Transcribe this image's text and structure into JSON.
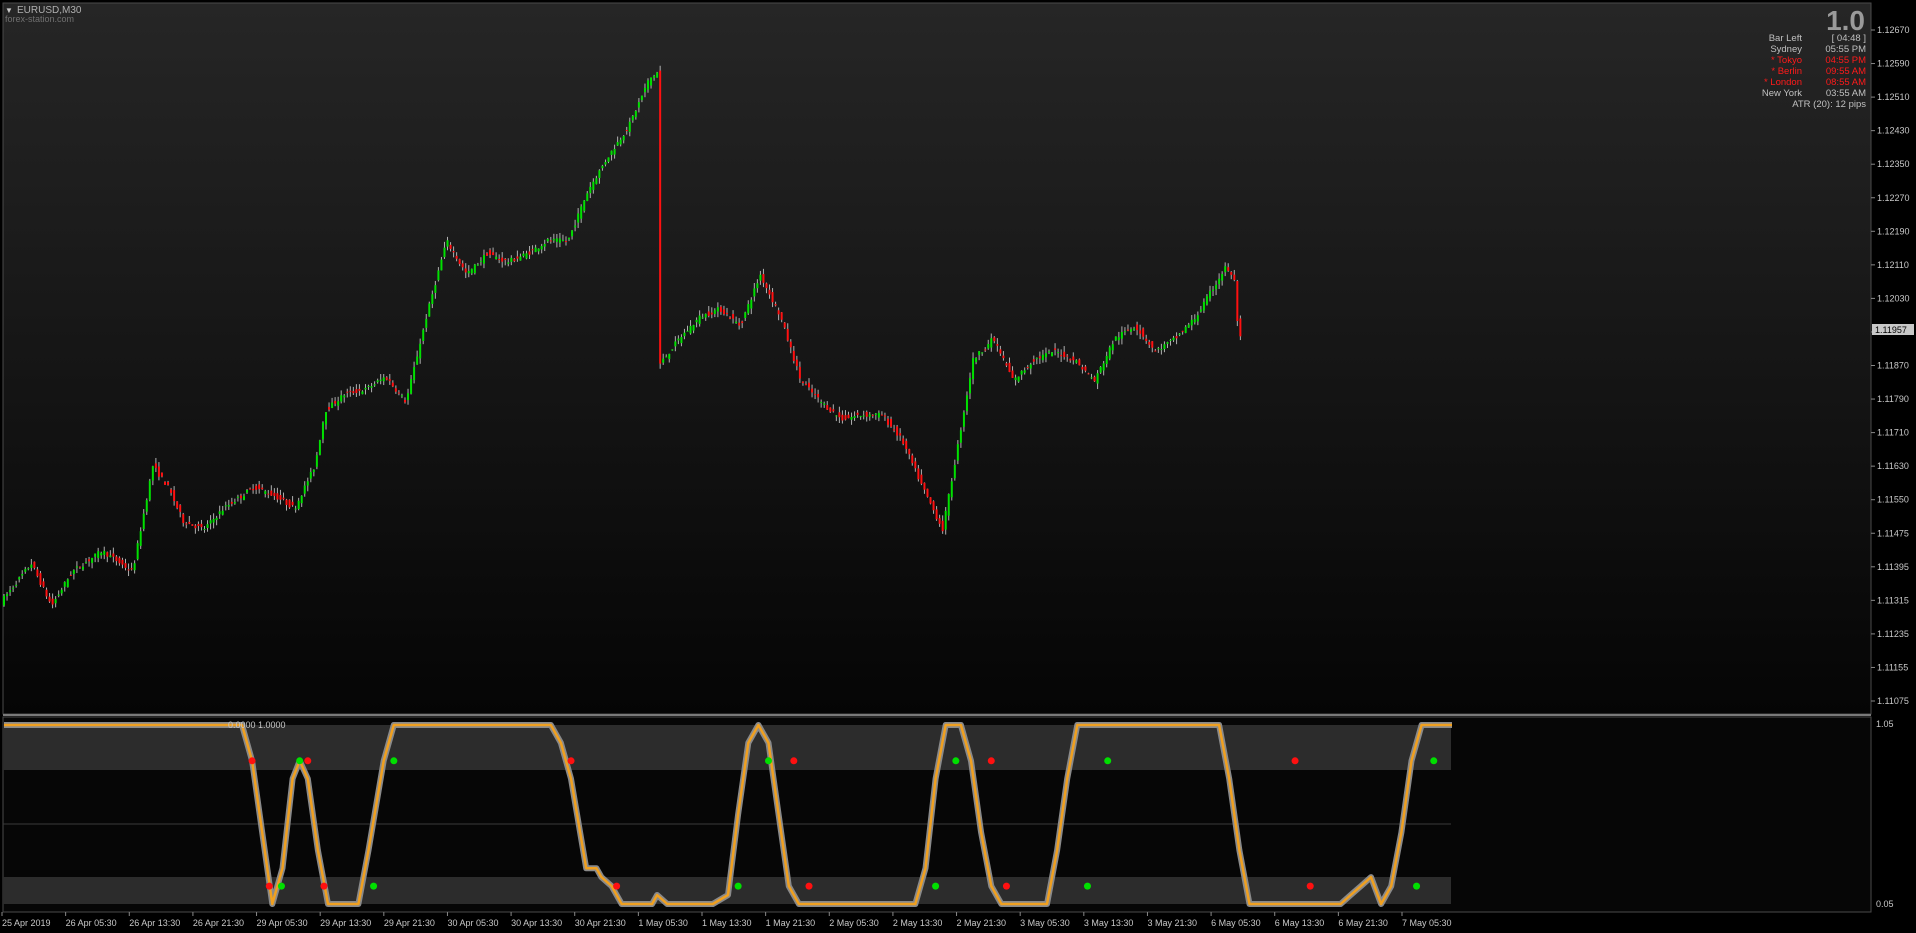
{
  "window": {
    "symbol_title": "EURUSD,M30",
    "watermark": "forex-station.com",
    "collapse_glyph": "▼"
  },
  "info_panel": {
    "big_value": "1.0",
    "rows": [
      {
        "label": "Bar Left",
        "value": "[ 04:48 ]",
        "color": "#c0c0c0"
      },
      {
        "label": "Sydney",
        "value": "05:55 PM",
        "color": "#c0c0c0"
      },
      {
        "label": "* Tokyo",
        "value": "04:55 PM",
        "color": "#ff1a1a"
      },
      {
        "label": "* Berlin",
        "value": "09:55 AM",
        "color": "#ff1a1a"
      },
      {
        "label": "* London",
        "value": "08:55 AM",
        "color": "#ff1a1a"
      },
      {
        "label": "New York",
        "value": "03:55 AM",
        "color": "#c0c0c0"
      }
    ],
    "atr_text": "ATR (20): 12 pips"
  },
  "price_axis": {
    "labels": [
      "1.12670",
      "1.12590",
      "1.12510",
      "1.12430",
      "1.12350",
      "1.12270",
      "1.12190",
      "1.12110",
      "1.12030",
      "1.11950",
      "1.11870",
      "1.11790",
      "1.11710",
      "1.11630",
      "1.11550",
      "1.11475",
      "1.11395",
      "1.11315",
      "1.11235",
      "1.11155",
      "1.11075"
    ],
    "current_price": "1.11957"
  },
  "time_axis": {
    "labels": [
      "25 Apr 2019",
      "26 Apr 05:30",
      "26 Apr 13:30",
      "26 Apr 21:30",
      "29 Apr 05:30",
      "29 Apr 13:30",
      "29 Apr 21:30",
      "30 Apr 05:30",
      "30 Apr 13:30",
      "30 Apr 21:30",
      "1 May 05:30",
      "1 May 13:30",
      "1 May 21:30",
      "2 May 05:30",
      "2 May 13:30",
      "2 May 21:30",
      "3 May 05:30",
      "3 May 13:30",
      "3 May 21:30",
      "6 May 05:30",
      "6 May 13:30",
      "6 May 21:30",
      "7 May 05:30"
    ]
  },
  "indicator": {
    "header": "0.0000 1.0000",
    "scale_top": "1.05",
    "scale_bottom": "0.05"
  },
  "colors": {
    "bull_candle": "#00e000",
    "bear_candle": "#ff1010",
    "wick": "#b0b0b0",
    "osc_line": "#f0a020",
    "osc_shadow": "#8a8a8a",
    "dot_up": "#00e000",
    "dot_down": "#ff1010",
    "axis_text": "#c8c8c8"
  },
  "chart_data": {
    "type": "candlestick",
    "symbol": "EURUSD",
    "timeframe": "M30",
    "ylim": [
      1.11075,
      1.127
    ],
    "price_path": [
      [
        0,
        1.1133
      ],
      [
        10,
        1.1136
      ],
      [
        30,
        1.1142
      ],
      [
        50,
        1.1132
      ],
      [
        70,
        1.114
      ],
      [
        100,
        1.1145
      ],
      [
        130,
        1.114
      ],
      [
        150,
        1.1165
      ],
      [
        165,
        1.116
      ],
      [
        180,
        1.1152
      ],
      [
        200,
        1.115
      ],
      [
        220,
        1.1155
      ],
      [
        250,
        1.116
      ],
      [
        270,
        1.1158
      ],
      [
        290,
        1.1155
      ],
      [
        310,
        1.1165
      ],
      [
        320,
        1.1178
      ],
      [
        340,
        1.1182
      ],
      [
        360,
        1.1183
      ],
      [
        380,
        1.1186
      ],
      [
        400,
        1.118
      ],
      [
        420,
        1.12
      ],
      [
        440,
        1.1218
      ],
      [
        460,
        1.121
      ],
      [
        480,
        1.1215
      ],
      [
        500,
        1.1213
      ],
      [
        520,
        1.1215
      ],
      [
        540,
        1.1218
      ],
      [
        560,
        1.1218
      ],
      [
        580,
        1.123
      ],
      [
        600,
        1.1238
      ],
      [
        620,
        1.1245
      ],
      [
        640,
        1.1256
      ],
      [
        650,
        1.1258
      ],
      [
        651,
        1.1189
      ],
      [
        670,
        1.1195
      ],
      [
        690,
        1.12
      ],
      [
        710,
        1.1202
      ],
      [
        730,
        1.1198
      ],
      [
        750,
        1.121
      ],
      [
        770,
        1.12
      ],
      [
        790,
        1.1185
      ],
      [
        810,
        1.118
      ],
      [
        830,
        1.1176
      ],
      [
        850,
        1.1177
      ],
      [
        870,
        1.1177
      ],
      [
        890,
        1.1171
      ],
      [
        910,
        1.116
      ],
      [
        930,
        1.115
      ],
      [
        940,
        1.1163
      ],
      [
        960,
        1.119
      ],
      [
        980,
        1.1195
      ],
      [
        1000,
        1.1185
      ],
      [
        1020,
        1.119
      ],
      [
        1040,
        1.1192
      ],
      [
        1060,
        1.119
      ],
      [
        1080,
        1.1185
      ],
      [
        1100,
        1.1195
      ],
      [
        1120,
        1.1198
      ],
      [
        1140,
        1.1192
      ],
      [
        1160,
        1.1195
      ],
      [
        1180,
        1.12
      ],
      [
        1200,
        1.1208
      ],
      [
        1210,
        1.1212
      ],
      [
        1219,
        1.1208
      ],
      [
        1222,
        1.1195
      ]
    ],
    "oscillator_path": [
      [
        0,
        1.0
      ],
      [
        235,
        1.0
      ],
      [
        245,
        0.8
      ],
      [
        255,
        0.4
      ],
      [
        265,
        0.0
      ],
      [
        275,
        0.2
      ],
      [
        285,
        0.7
      ],
      [
        292,
        0.8
      ],
      [
        300,
        0.7
      ],
      [
        310,
        0.3
      ],
      [
        320,
        0.0
      ],
      [
        350,
        0.0
      ],
      [
        360,
        0.3
      ],
      [
        375,
        0.8
      ],
      [
        385,
        1.0
      ],
      [
        540,
        1.0
      ],
      [
        550,
        0.9
      ],
      [
        560,
        0.7
      ],
      [
        575,
        0.2
      ],
      [
        585,
        0.2
      ],
      [
        590,
        0.15
      ],
      [
        600,
        0.1
      ],
      [
        610,
        0.0
      ],
      [
        640,
        0.0
      ],
      [
        645,
        0.05
      ],
      [
        655,
        0.0
      ],
      [
        680,
        0.0
      ],
      [
        700,
        0.0
      ],
      [
        715,
        0.05
      ],
      [
        725,
        0.5
      ],
      [
        735,
        0.9
      ],
      [
        745,
        1.0
      ],
      [
        755,
        0.9
      ],
      [
        765,
        0.5
      ],
      [
        775,
        0.1
      ],
      [
        785,
        0.0
      ],
      [
        900,
        0.0
      ],
      [
        910,
        0.2
      ],
      [
        920,
        0.7
      ],
      [
        930,
        1.0
      ],
      [
        945,
        1.0
      ],
      [
        955,
        0.8
      ],
      [
        965,
        0.4
      ],
      [
        975,
        0.1
      ],
      [
        985,
        0.0
      ],
      [
        1030,
        0.0
      ],
      [
        1040,
        0.3
      ],
      [
        1050,
        0.7
      ],
      [
        1060,
        1.0
      ],
      [
        1200,
        1.0
      ],
      [
        1210,
        0.7
      ],
      [
        1220,
        0.3
      ],
      [
        1230,
        0.0
      ],
      [
        1320,
        0.0
      ],
      [
        1330,
        0.05
      ],
      [
        1340,
        0.1
      ],
      [
        1350,
        0.15
      ],
      [
        1360,
        0.0
      ],
      [
        1370,
        0.1
      ],
      [
        1380,
        0.4
      ],
      [
        1390,
        0.8
      ],
      [
        1400,
        1.0
      ],
      [
        1430,
        1.0
      ]
    ],
    "signal_dots": [
      {
        "i": 245,
        "v": 0.8,
        "dir": "down"
      },
      {
        "i": 262,
        "v": 0.1,
        "dir": "down"
      },
      {
        "i": 274,
        "v": 0.1,
        "dir": "up"
      },
      {
        "i": 292,
        "v": 0.8,
        "dir": "up"
      },
      {
        "i": 300,
        "v": 0.8,
        "dir": "down"
      },
      {
        "i": 316,
        "v": 0.1,
        "dir": "down"
      },
      {
        "i": 365,
        "v": 0.1,
        "dir": "up"
      },
      {
        "i": 385,
        "v": 0.8,
        "dir": "up"
      },
      {
        "i": 560,
        "v": 0.8,
        "dir": "down"
      },
      {
        "i": 605,
        "v": 0.1,
        "dir": "down"
      },
      {
        "i": 725,
        "v": 0.1,
        "dir": "up"
      },
      {
        "i": 755,
        "v": 0.8,
        "dir": "up"
      },
      {
        "i": 780,
        "v": 0.8,
        "dir": "down"
      },
      {
        "i": 795,
        "v": 0.1,
        "dir": "down"
      },
      {
        "i": 920,
        "v": 0.1,
        "dir": "up"
      },
      {
        "i": 940,
        "v": 0.8,
        "dir": "up"
      },
      {
        "i": 975,
        "v": 0.8,
        "dir": "down"
      },
      {
        "i": 990,
        "v": 0.1,
        "dir": "down"
      },
      {
        "i": 1070,
        "v": 0.1,
        "dir": "up"
      },
      {
        "i": 1090,
        "v": 0.8,
        "dir": "up"
      },
      {
        "i": 1275,
        "v": 0.8,
        "dir": "down"
      },
      {
        "i": 1290,
        "v": 0.1,
        "dir": "down"
      },
      {
        "i": 1395,
        "v": 0.1,
        "dir": "up"
      },
      {
        "i": 1412,
        "v": 0.8,
        "dir": "up"
      }
    ]
  }
}
